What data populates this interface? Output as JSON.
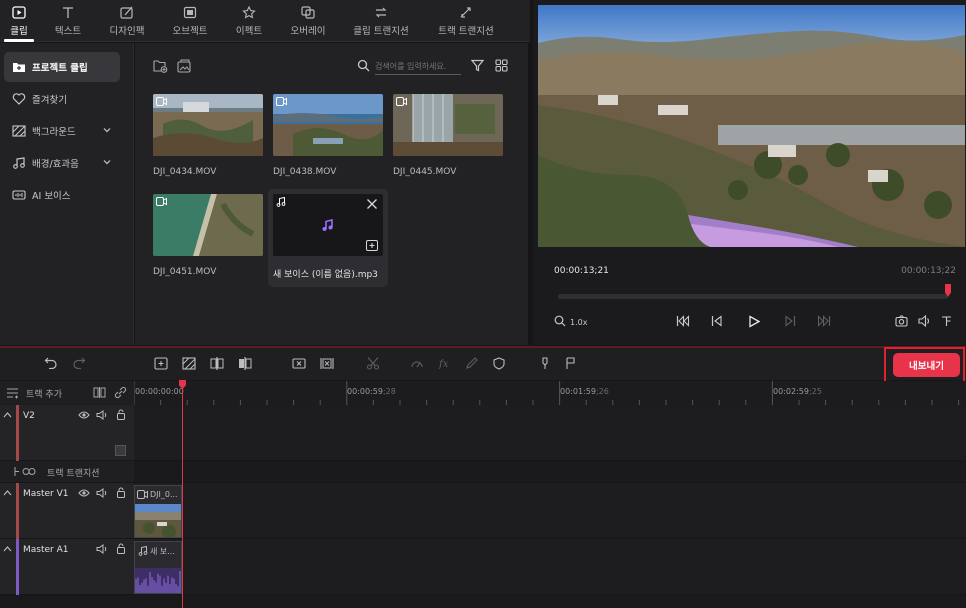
{
  "tabs": [
    {
      "label": "클립",
      "icon": "clip-icon",
      "active": true
    },
    {
      "label": "텍스트",
      "icon": "text-icon"
    },
    {
      "label": "디자인팩",
      "icon": "design-pack-icon"
    },
    {
      "label": "오브젝트",
      "icon": "object-icon"
    },
    {
      "label": "이펙트",
      "icon": "effect-icon"
    },
    {
      "label": "오버레이",
      "icon": "overlay-icon"
    },
    {
      "label": "클립 트랜지션",
      "icon": "clip-transition-icon"
    },
    {
      "label": "트랙 트랜지션",
      "icon": "track-transition-icon"
    }
  ],
  "sidebar": {
    "items": [
      {
        "label": "프로젝트 클립",
        "icon": "folder-icon",
        "active": true
      },
      {
        "label": "즐겨찾기",
        "icon": "heart-icon"
      },
      {
        "label": "백그라운드",
        "icon": "background-icon",
        "chevron": true
      },
      {
        "label": "배경/효과음",
        "icon": "music-note-icon",
        "chevron": true
      },
      {
        "label": "AI 보이스",
        "icon": "ai-voice-icon"
      }
    ]
  },
  "media": {
    "search_placeholder": "검색어를 입력하세요.",
    "clips": [
      {
        "name": "DJI_0434.MOV",
        "type": "video"
      },
      {
        "name": "DJI_0438.MOV",
        "type": "video"
      },
      {
        "name": "DJI_0445.MOV",
        "type": "video"
      },
      {
        "name": "DJI_0451.MOV",
        "type": "video"
      },
      {
        "name": "새 보이스 (이름 없음).mp3",
        "type": "audio"
      }
    ]
  },
  "preview": {
    "current_time": "00:00:13;21",
    "total_time": "00:00:13;22",
    "zoom": "1.0x"
  },
  "export_label": "내보내기",
  "timeline": {
    "add_track": "트랙 추가",
    "ruler": [
      {
        "main": "00:00:00",
        "frames": "00"
      },
      {
        "main": "00:00:59",
        "frames": ";28"
      },
      {
        "main": "00:01:59",
        "frames": ";26"
      },
      {
        "main": "00:02:59",
        "frames": ";25"
      }
    ],
    "tracks": {
      "v2": "V2",
      "transition": "트랙 트랜지션",
      "v1": "Master V1",
      "a1": "Master A1"
    },
    "v1_clip": "DJI_0...",
    "a1_clip": "새 보..."
  },
  "colors": {
    "accent": "#e8344a",
    "audio": "#7c5cc4",
    "playhead": "#e8344a"
  }
}
